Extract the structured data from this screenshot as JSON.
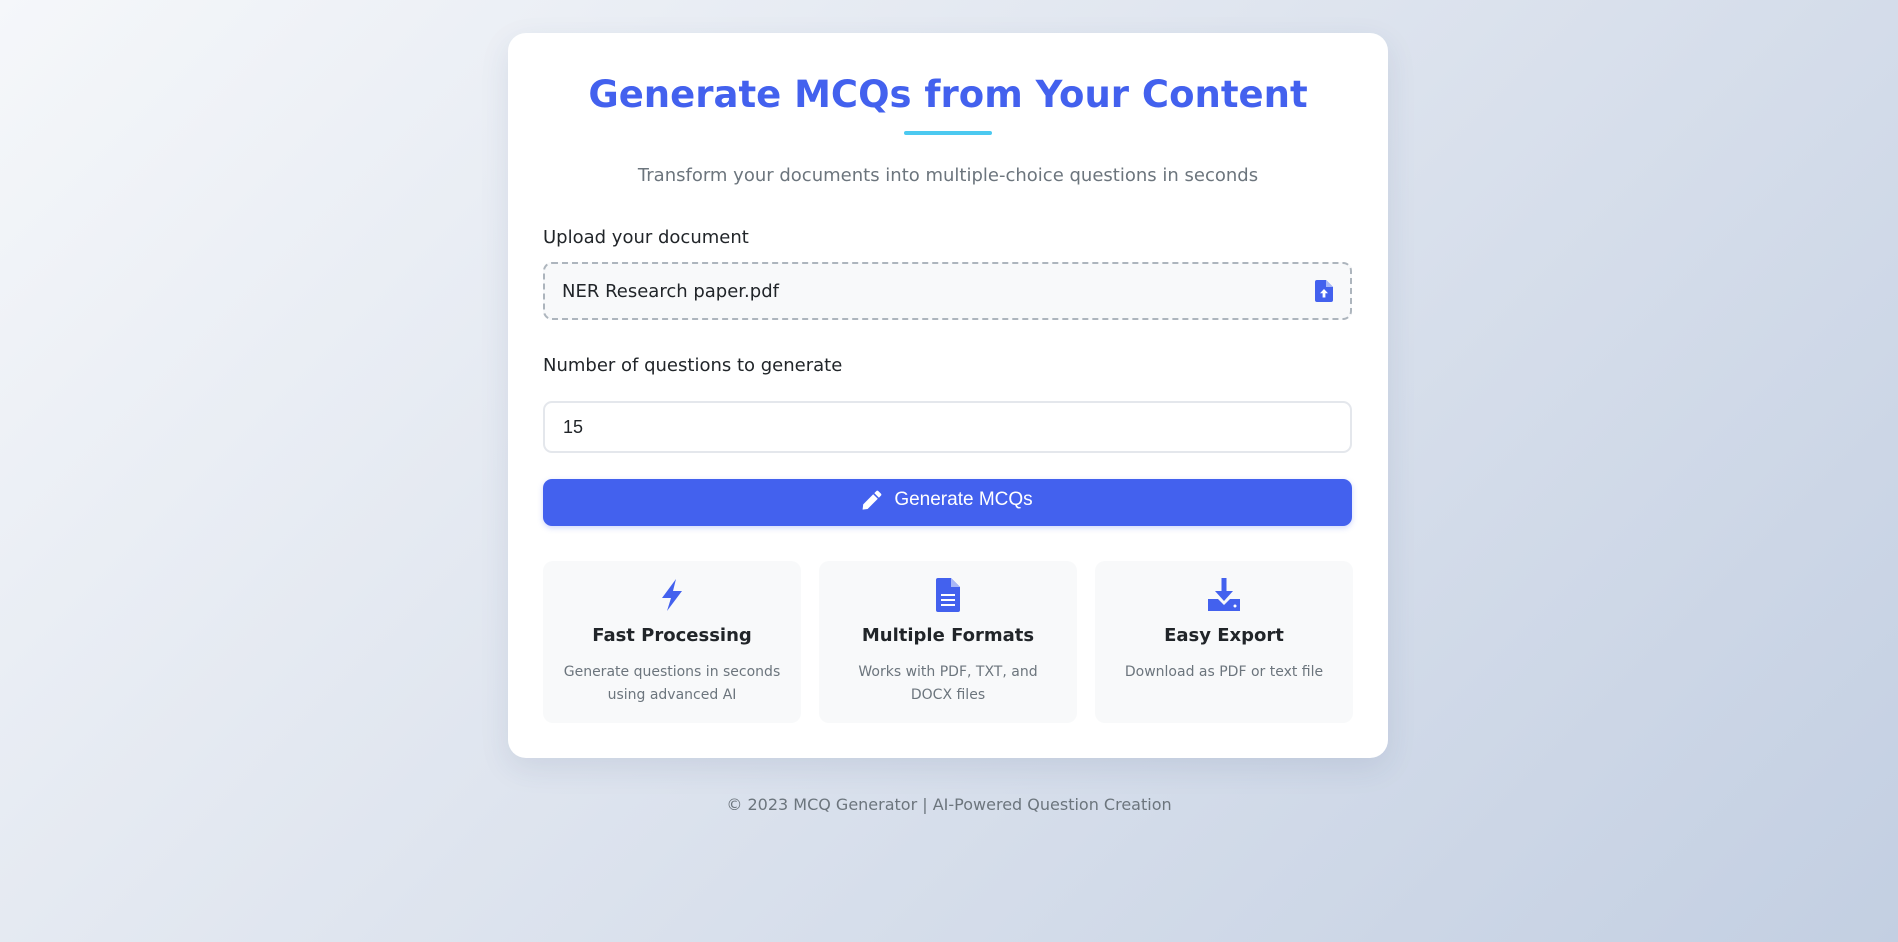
{
  "page": {
    "title": "Generate MCQs from Your Content",
    "subtitle": "Transform your documents into multiple-choice questions in seconds"
  },
  "upload": {
    "label": "Upload your document",
    "file_name": "NER Research paper.pdf",
    "icon": "file-upload-icon"
  },
  "questions": {
    "label": "Number of questions to generate",
    "value": "15"
  },
  "generate_button": {
    "label": "Generate MCQs",
    "icon": "pencil-icon"
  },
  "features": [
    {
      "icon": "bolt-icon",
      "title": "Fast Processing",
      "description": "Generate questions in seconds using advanced AI"
    },
    {
      "icon": "file-text-icon",
      "title": "Multiple Formats",
      "description": "Works with PDF, TXT, and DOCX files"
    },
    {
      "icon": "download-icon",
      "title": "Easy Export",
      "description": "Download as PDF or text file"
    }
  ],
  "footer": {
    "text": "© 2023 MCQ Generator | AI-Powered Question Creation"
  },
  "colors": {
    "primary": "#4361ee",
    "accent": "#4cc9f0",
    "text_dark": "#212529",
    "text_muted": "#6c757d"
  }
}
